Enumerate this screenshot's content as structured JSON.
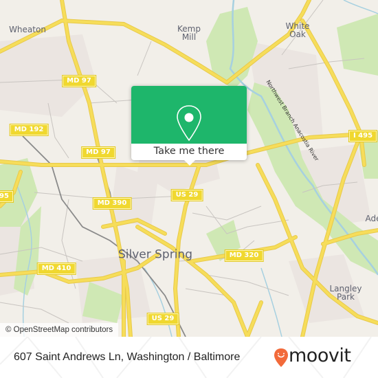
{
  "map": {
    "places": [
      {
        "id": "wheaton",
        "label": "Wheaton",
        "size": "mid"
      },
      {
        "id": "kemp-mill",
        "label": "Kemp\nMill",
        "size": "mid"
      },
      {
        "id": "white-oak",
        "label": "White\nOak",
        "size": "mid"
      },
      {
        "id": "silver-spring",
        "label": "Silver Spring",
        "size": "big"
      },
      {
        "id": "langley-park",
        "label": "Langley\nPark",
        "size": "mid"
      },
      {
        "id": "adelphi",
        "label": "Ade",
        "size": "mid"
      }
    ],
    "shields": [
      {
        "id": "md97-north",
        "label": "MD 97"
      },
      {
        "id": "md192",
        "label": "MD 192"
      },
      {
        "id": "md97-south",
        "label": "MD 97"
      },
      {
        "id": "i495-east",
        "label": "I 495"
      },
      {
        "id": "i495-west",
        "label": "95"
      },
      {
        "id": "md390",
        "label": "MD 390"
      },
      {
        "id": "us29-north",
        "label": "US 29"
      },
      {
        "id": "md320",
        "label": "MD 320"
      },
      {
        "id": "md410",
        "label": "MD 410"
      },
      {
        "id": "us29-south",
        "label": "US 29"
      }
    ],
    "river_label": "Northwest Branch Anacostia River",
    "attribution": "© OpenStreetMap contributors",
    "colors": {
      "background": "#f2efe9",
      "road": "#f6dd5a",
      "park": "#cfe8b4",
      "water": "#a6d0e0",
      "rail": "#777777"
    }
  },
  "popup": {
    "icon": "map-pin-icon",
    "button_label": "Take me there",
    "accent": "#1eb66b"
  },
  "footer": {
    "address": "607 Saint Andrews Ln, Washington / Baltimore",
    "brand": "moovit",
    "brand_color": "#f26a3a"
  }
}
